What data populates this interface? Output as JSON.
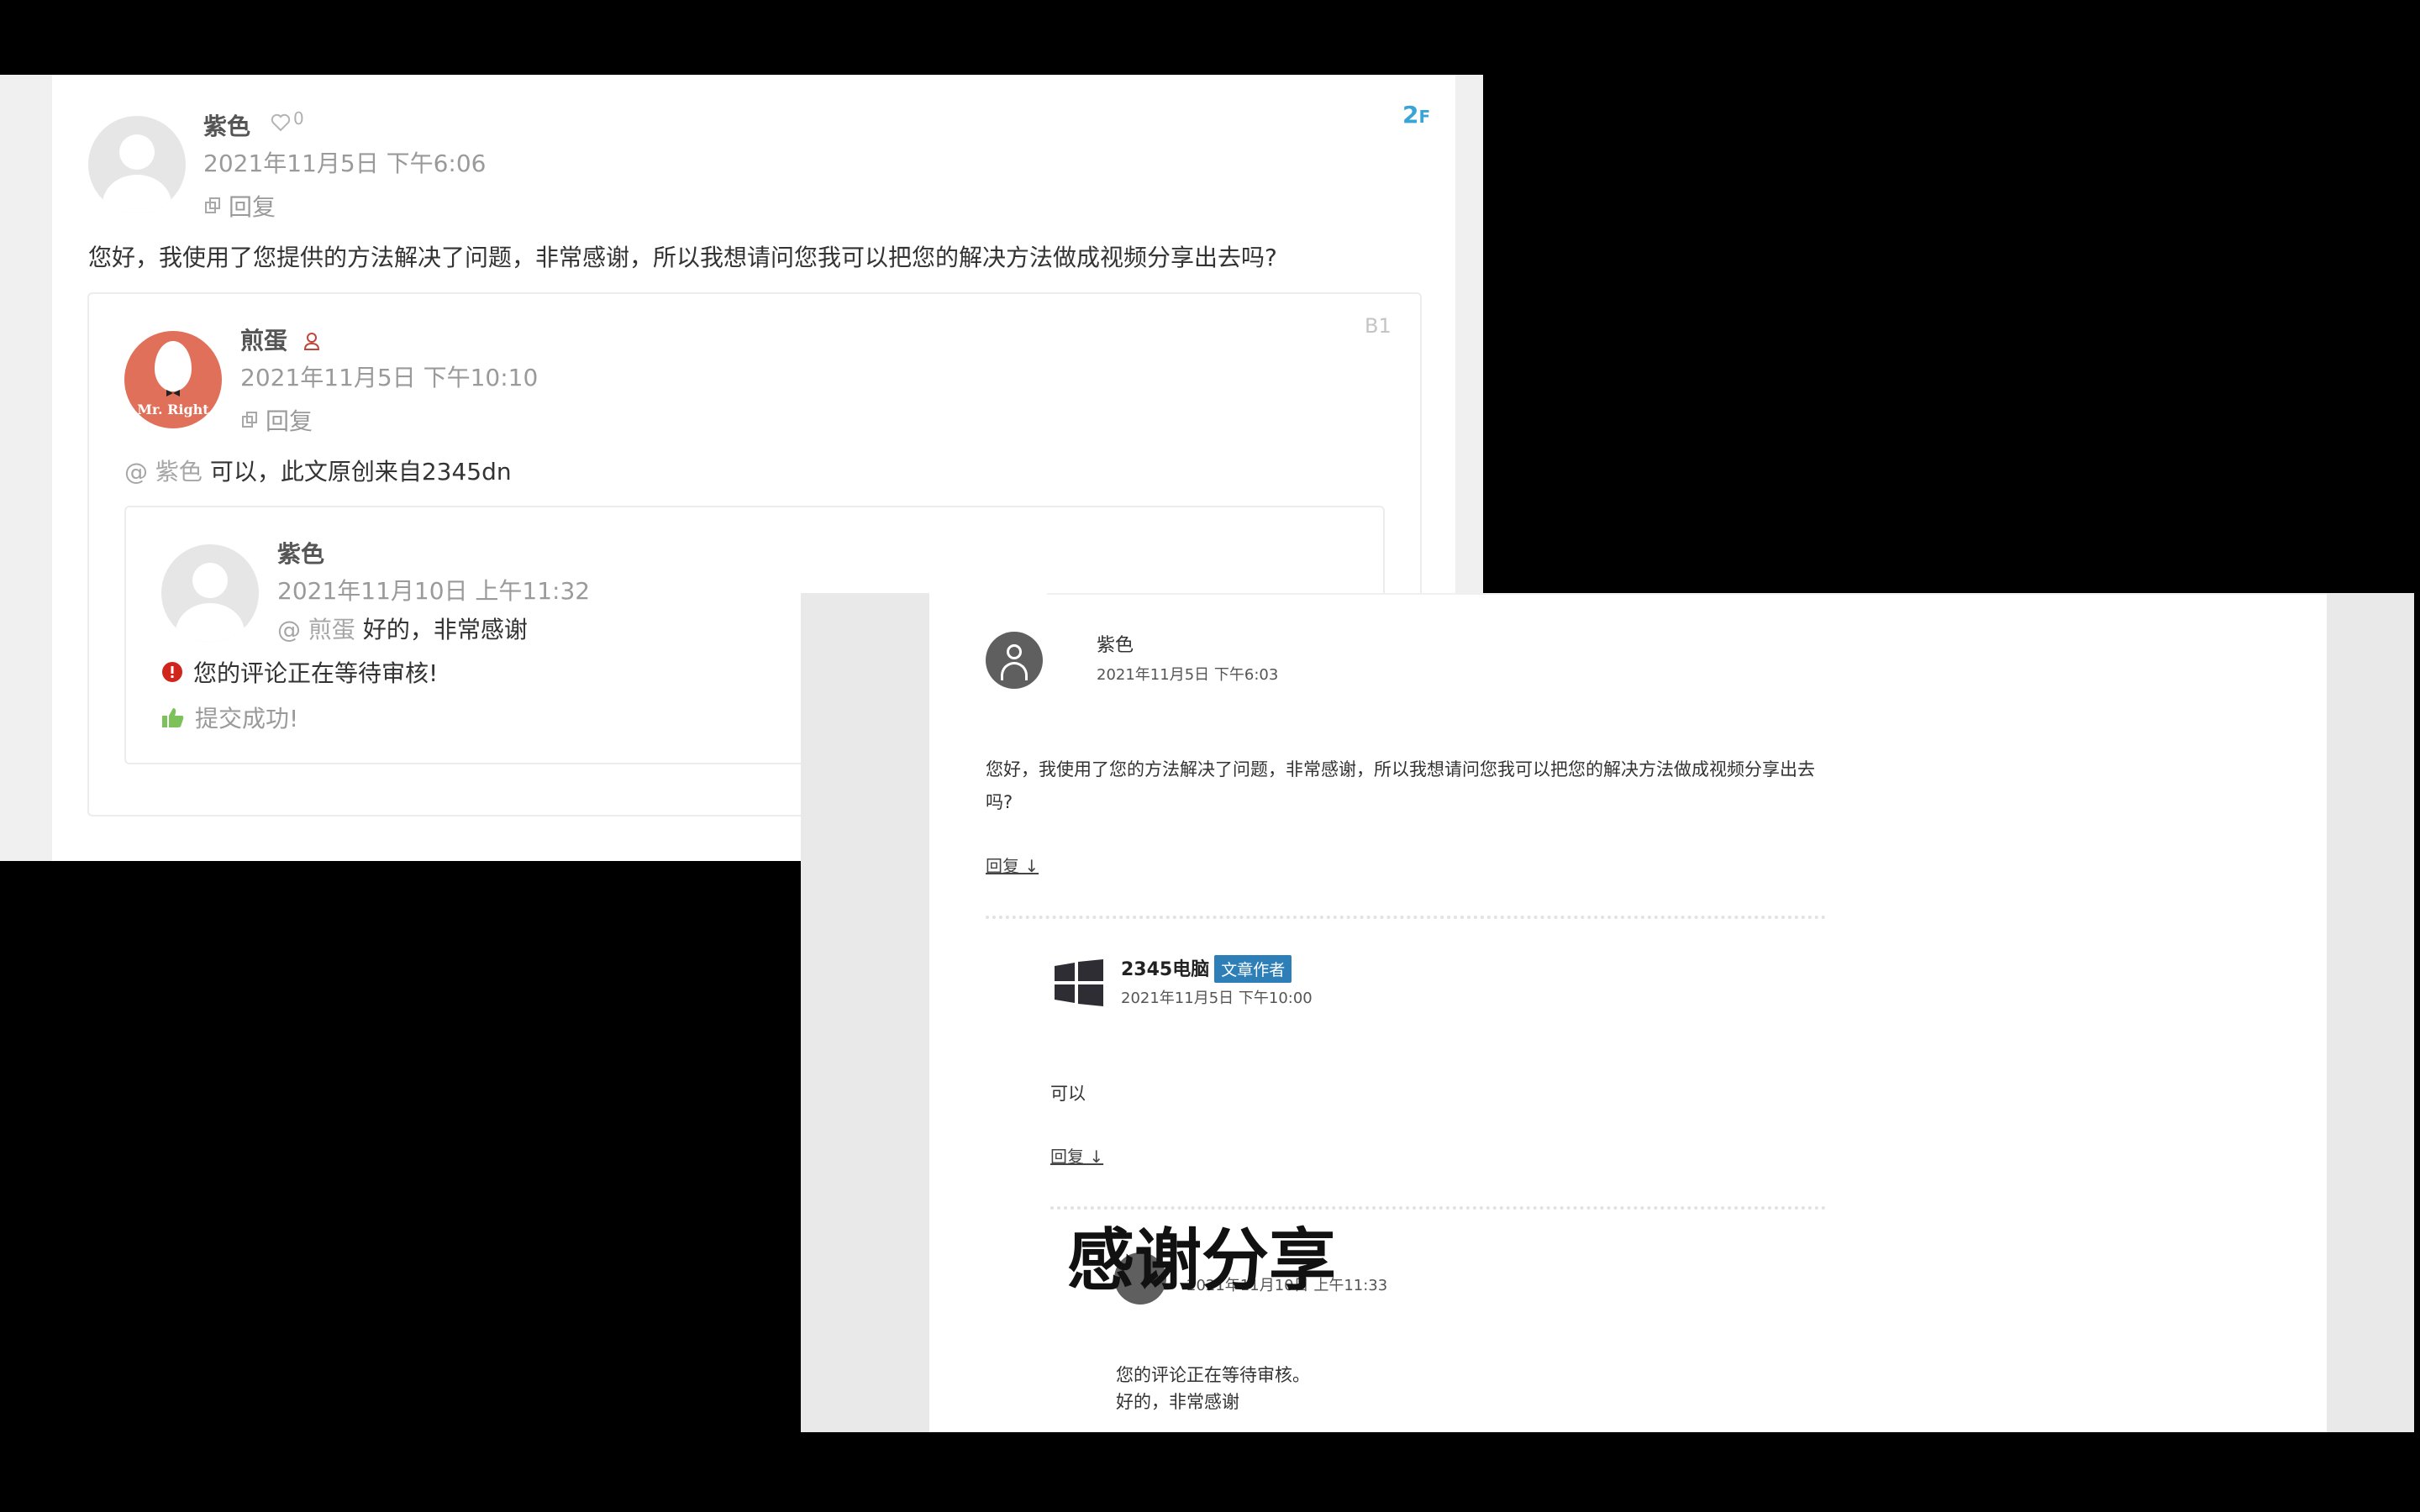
{
  "left_screenshot": {
    "floor_number": "2",
    "floor_suffix": "F",
    "comment": {
      "author": "紫色",
      "like_count": "0",
      "time": "2021年11月5日 下午6:06",
      "reply_label": "回复",
      "text": "您好，我使用了您提供的方法解决了问题，非常感谢，所以我想请问您我可以把您的解决方法做成视频分享出去吗?"
    },
    "reply1": {
      "floor": "B1",
      "author": "煎蛋",
      "avatar_text": "Mr. Right",
      "time": "2021年11月5日 下午10:10",
      "reply_label": "回复",
      "mention": "@ 紫色",
      "text": "可以，此文原创来自2345dn"
    },
    "reply2": {
      "author": "紫色",
      "time": "2021年11月10日 上午11:32",
      "mention": "@ 煎蛋",
      "text": "好的，非常感谢",
      "status_pending": "您的评论正在等待审核!",
      "status_success": "提交成功!"
    }
  },
  "right_screenshot": {
    "comment": {
      "author": "紫色",
      "time": "2021年11月5日 下午6:03",
      "text": "您好，我使用了您的方法解决了问题，非常感谢，所以我想请问您我可以把您的解决方法做成视频分享出去吗?",
      "reply_label": "回复 ↓"
    },
    "author_reply": {
      "author": "2345电脑",
      "badge": "文章作者",
      "time": "2021年11月5日 下午10:00",
      "text": "可以",
      "reply_label": "回复 ↓"
    },
    "followup": {
      "time_visible": "2021年11月10日 上午11:33",
      "pending": "您的评论正在等待审核。",
      "text": "好的，非常感谢"
    },
    "overlay_caption": "感谢分享"
  },
  "colors": {
    "accent_blue": "#3aa4d6",
    "badge_blue": "#2e7fb8",
    "danger_red": "#d0241c",
    "success_green": "#7dc15a",
    "avatar_orange": "#e0705a"
  }
}
